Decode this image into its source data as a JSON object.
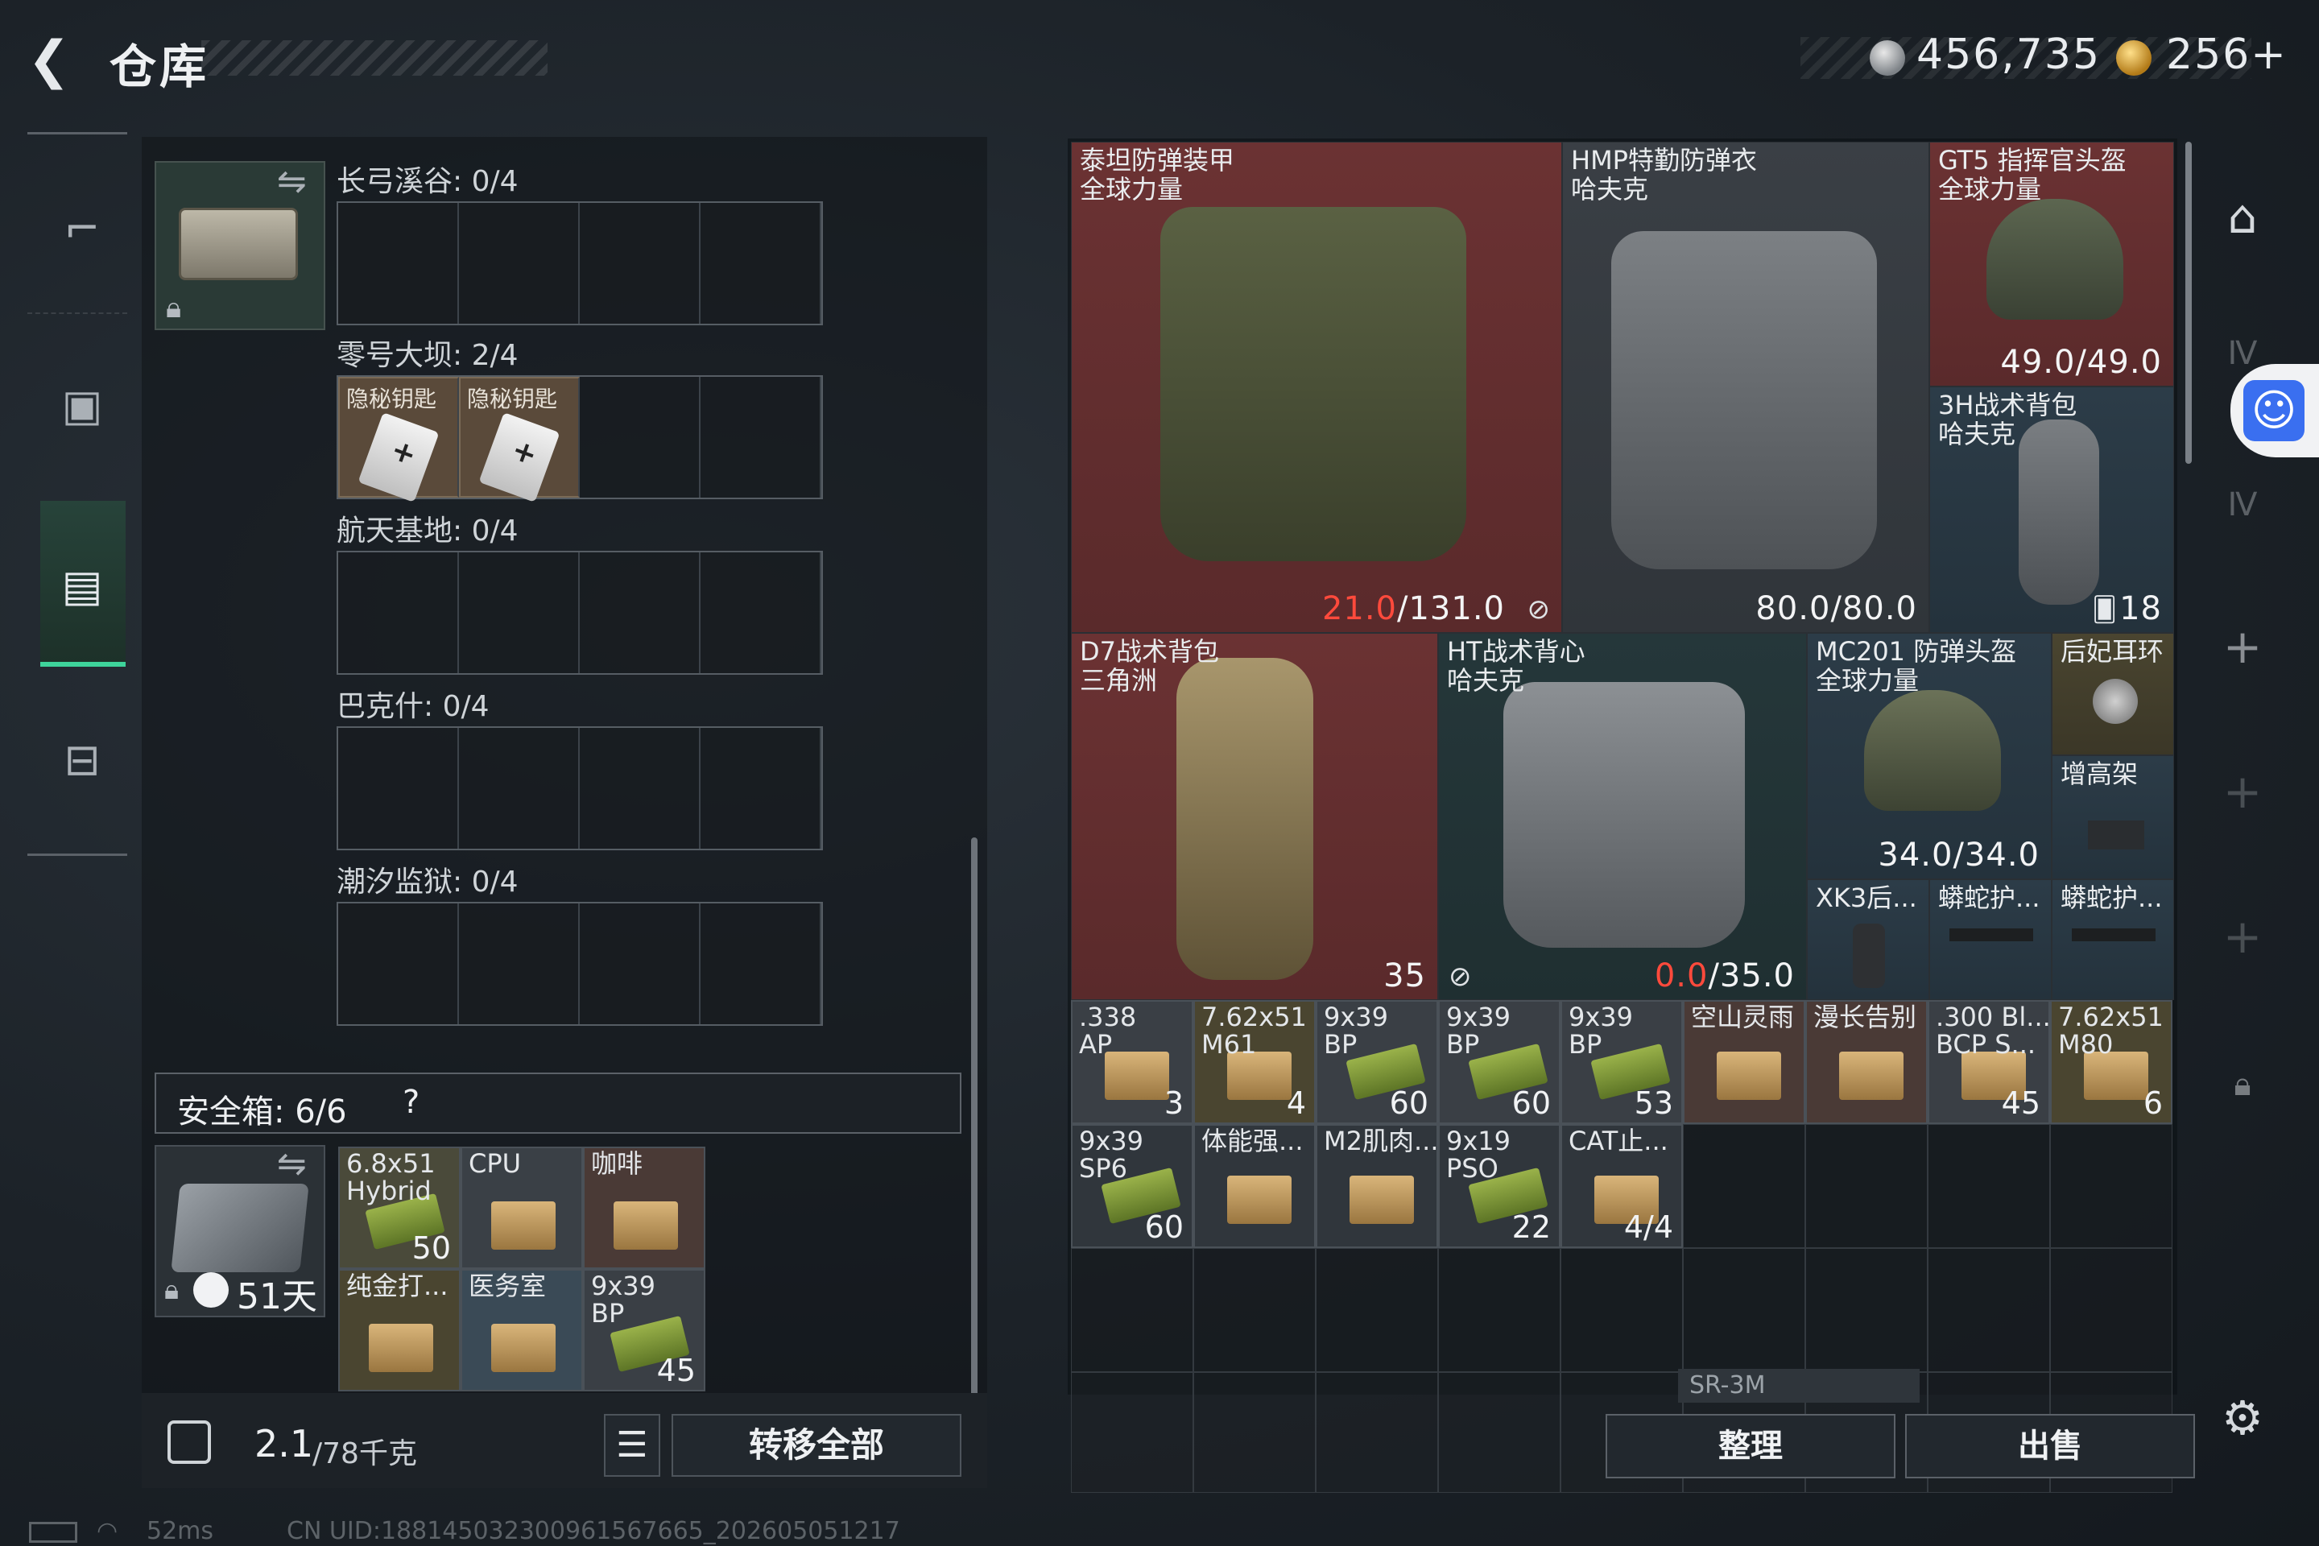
{
  "header": {
    "back_icon": "←",
    "title": "仓库",
    "silver": "456,735",
    "gold": "256+"
  },
  "left_nav": [
    {
      "name": "weapon",
      "icon": "gun-icon"
    },
    {
      "name": "gear",
      "icon": "backpack-icon"
    },
    {
      "name": "warehouse",
      "icon": "case-icon",
      "active": true
    },
    {
      "name": "tools",
      "icon": "toolbox-icon"
    }
  ],
  "keycase": {
    "sections": [
      {
        "label": "长弓溪谷: 0/4",
        "items": []
      },
      {
        "label": "零号大坝: 2/4",
        "items": [
          "隐秘钥匙",
          "隐秘钥匙"
        ]
      },
      {
        "label": "航天基地: 0/4",
        "items": []
      },
      {
        "label": "巴克什: 0/4",
        "items": []
      },
      {
        "label": "潮汐监狱: 0/4",
        "items": []
      }
    ]
  },
  "safe": {
    "label": "安全箱:  6/6",
    "help": "?",
    "days": "51天",
    "items": [
      {
        "name": "6.8x51\nHybrid",
        "count": "50"
      },
      {
        "name": "CPU",
        "count": ""
      },
      {
        "name": "咖啡",
        "count": ""
      },
      {
        "name": "纯金打...",
        "count": ""
      },
      {
        "name": "医务室",
        "count": ""
      },
      {
        "name": "9x39\nBP",
        "count": "45"
      }
    ]
  },
  "left_footer": {
    "weight": "2.1",
    "capacity": "/78千克",
    "transfer_all": "转移全部"
  },
  "stash": {
    "big_items": [
      {
        "label": "泰坦防弹装甲\n全球力量",
        "value_red": "21.0",
        "value_rest": "/131.0"
      },
      {
        "label": "HMP特勤防弹衣\n哈夫克",
        "value": "80.0/80.0"
      },
      {
        "label": "GT5 指挥官头盔\n全球力量",
        "value": "49.0/49.0"
      },
      {
        "label": "3H战术背包\n哈夫克",
        "value": "18"
      },
      {
        "label": "D7战术背包\n三角洲",
        "value": "35"
      },
      {
        "label": "HT战术背心\n哈夫克",
        "value_red": "0.0",
        "value_rest": "/35.0"
      },
      {
        "label": "MC201 防弹头盔\n全球力量",
        "value": "34.0/34.0"
      },
      {
        "label": "后妃耳环",
        "value": ""
      },
      {
        "label": "增高架",
        "value": ""
      },
      {
        "label": "XK3后...",
        "value": ""
      },
      {
        "label": "蟒蛇护...",
        "value": ""
      },
      {
        "label": "蟒蛇护...",
        "value": ""
      }
    ],
    "row1": [
      {
        "name": ".338\nAP",
        "count": "3"
      },
      {
        "name": "7.62x51\nM61",
        "count": "4"
      },
      {
        "name": "9x39\nBP",
        "count": "60"
      },
      {
        "name": "9x39\nBP",
        "count": "60"
      },
      {
        "name": "9x39\nBP",
        "count": "53"
      },
      {
        "name": "空山灵雨",
        "count": ""
      },
      {
        "name": "漫长告别",
        "count": ""
      },
      {
        "name": ".300 Bl...\nBCP S...",
        "count": "45"
      },
      {
        "name": "7.62x51\nM80",
        "count": "6"
      }
    ],
    "row2": [
      {
        "name": "9x39\nSP6",
        "count": "60"
      },
      {
        "name": "体能强...",
        "count": ""
      },
      {
        "name": "M2肌肉...",
        "count": ""
      },
      {
        "name": "9x19\nPSO",
        "count": "22"
      },
      {
        "name": "CAT止...",
        "count": "4/4"
      }
    ],
    "sr3m": "SR-3M",
    "organize": "整理",
    "sell": "出售"
  },
  "status": {
    "ping": "52ms",
    "uid": "CN UID:18814503230096156766​5_202605051217"
  },
  "colors": {
    "accent_green": "#3ed49b",
    "damaged_red": "#ff4a3c",
    "access_blue": "#3a6ff0"
  }
}
